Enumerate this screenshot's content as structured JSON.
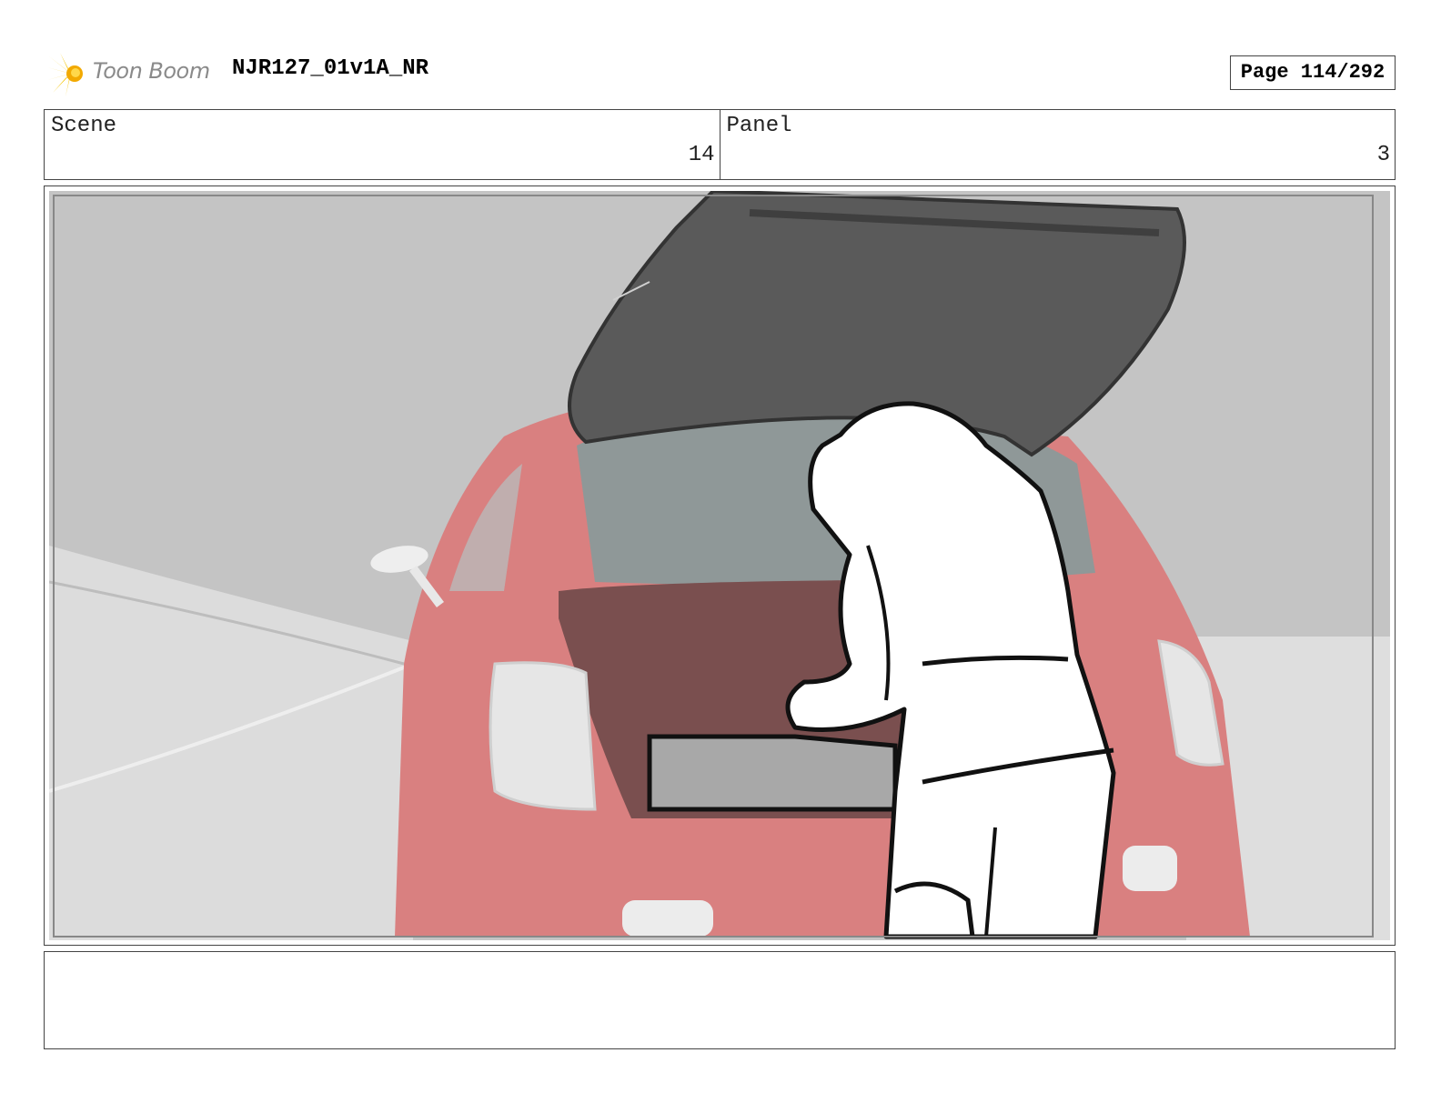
{
  "header": {
    "logo_text": "Toon Boom",
    "project_title": "NJR127_01v1A_NR",
    "page_label": "Page 114/292"
  },
  "info": {
    "scene_label": "Scene",
    "scene_value": "14",
    "panel_label": "Panel",
    "panel_value": "3"
  },
  "frame": {
    "icon": "storyboard-drawing",
    "colors": {
      "car": "#d97070",
      "hatch": "#5a5a5a",
      "sky": "#c2c2c2",
      "ground": "#dcdcdc"
    }
  },
  "notes": {
    "text": ""
  }
}
